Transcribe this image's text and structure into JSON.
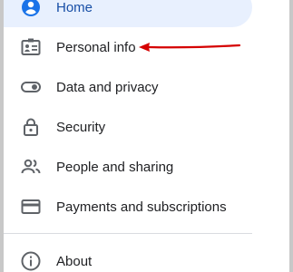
{
  "nav": {
    "items": [
      {
        "label": "Home",
        "icon": "home-icon",
        "active": true
      },
      {
        "label": "Personal info",
        "icon": "id-card-icon",
        "active": false
      },
      {
        "label": "Data and privacy",
        "icon": "toggle-icon",
        "active": false
      },
      {
        "label": "Security",
        "icon": "lock-icon",
        "active": false
      },
      {
        "label": "People and sharing",
        "icon": "people-icon",
        "active": false
      },
      {
        "label": "Payments and subscriptions",
        "icon": "credit-card-icon",
        "active": false
      }
    ],
    "footer_items": [
      {
        "label": "About",
        "icon": "info-icon"
      }
    ]
  },
  "annotation": {
    "arrow_color": "#d50000",
    "points_to": "Personal info"
  },
  "colors": {
    "active_bg": "#e8f0fe",
    "active_text": "#174ea6",
    "icon": "#5f6368",
    "text": "#202124"
  }
}
